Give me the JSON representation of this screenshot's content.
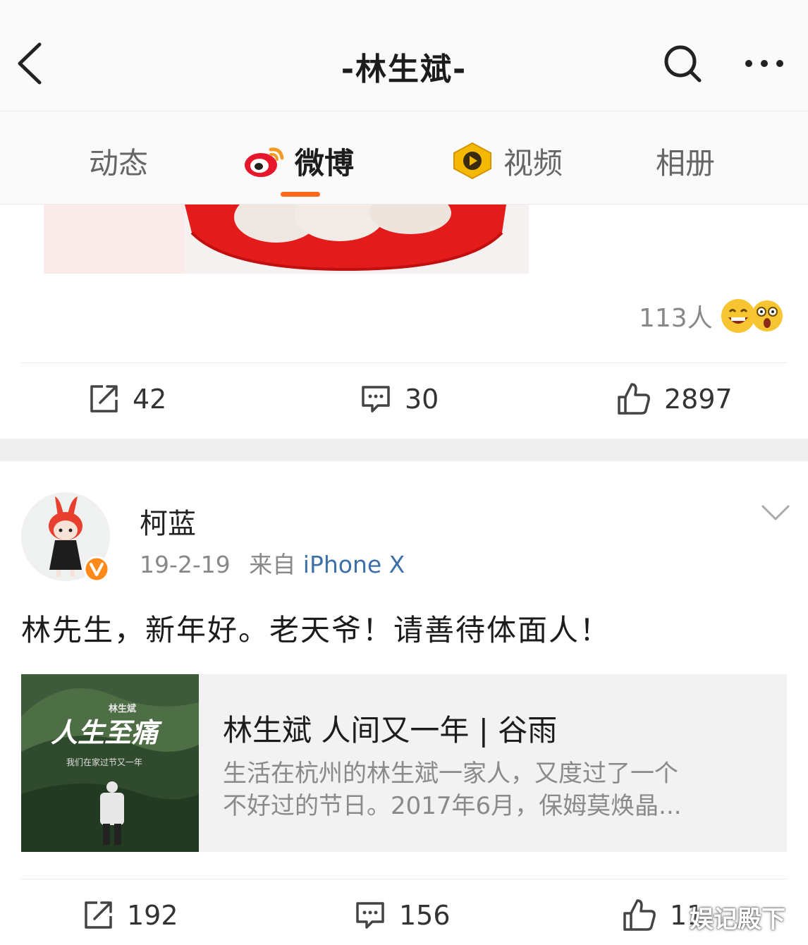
{
  "header": {
    "title": "-林生斌-"
  },
  "tabs": [
    {
      "label": "动态",
      "active": false
    },
    {
      "label": "微博",
      "active": true
    },
    {
      "label": "视频",
      "active": false
    },
    {
      "label": "相册",
      "active": false
    }
  ],
  "colors": {
    "accent": "#ff6a1a",
    "link": "#3d6fa8",
    "weibo_red": "#e6162d"
  },
  "post1": {
    "reactions_count": "113人",
    "repost_count": "42",
    "comment_count": "30",
    "like_count": "2897"
  },
  "post2": {
    "username": "柯蓝",
    "date": "19-2-19",
    "source_prefix": "来自",
    "source": "iPhone X",
    "text": "林先生，新年好。老天爷！请善待体面人！",
    "card": {
      "thumb_title": "人生至痛",
      "thumb_subtitle": "我们在家过节又一年",
      "thumb_author": "林生斌",
      "title": "林生斌 人间又一年 | 谷雨",
      "desc_line1": "生活在杭州的林生斌一家人，又度过了一个",
      "desc_line2": "不好过的节日。2017年6月，保姆莫焕晶..."
    },
    "repost_count": "192",
    "comment_count": "156",
    "like_count": "11"
  },
  "watermark": "娱记殿下"
}
